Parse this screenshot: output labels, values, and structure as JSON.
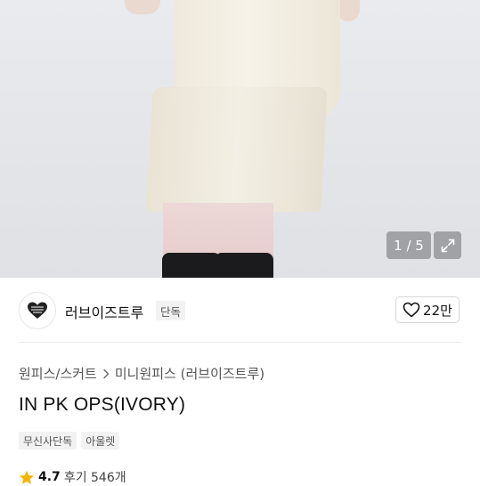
{
  "gallery": {
    "counter": "1 / 5",
    "expand_icon": "expand-icon"
  },
  "brand": {
    "name": "러브이즈트루",
    "badge": "단독",
    "logo_icon": "heart-logo-icon"
  },
  "like": {
    "icon": "heart-outline-icon",
    "count": "22만"
  },
  "breadcrumb": {
    "category": "원피스/스커트",
    "subcategory": "미니원피스 (러브이즈트루)",
    "separator_icon": "chevron-right-icon"
  },
  "product": {
    "title": "IN PK OPS(IVORY)",
    "tags": [
      "무신사단독",
      "아울렛"
    ]
  },
  "rating": {
    "icon": "star-icon",
    "value": "4.7",
    "reviews": "후기 546개"
  },
  "colors": {
    "star": "#f5b400",
    "counter_bg": "rgba(110,110,115,0.55)",
    "tag_bg": "#f2f2f2"
  }
}
